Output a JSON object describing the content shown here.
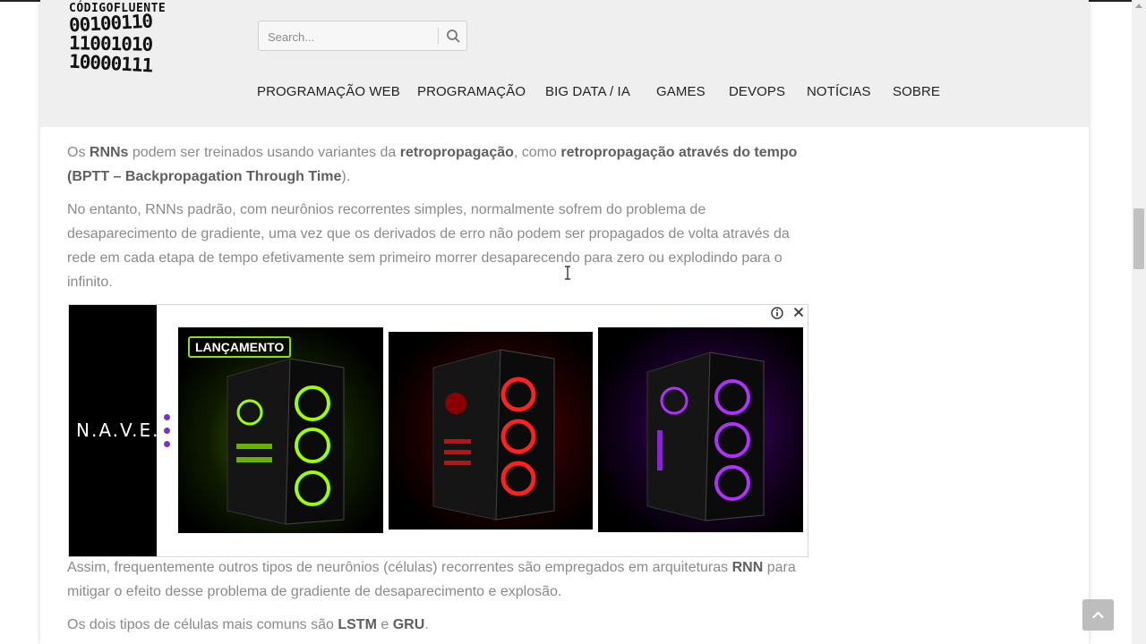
{
  "logo": {
    "brand": "CÓDIGOFLUENTE",
    "bits": [
      "00100110",
      "11001010",
      "10000111"
    ]
  },
  "search": {
    "placeholder": "Search...",
    "icon": "search-icon"
  },
  "nav": {
    "items": [
      "PROGRAMAÇÃO WEB",
      "PROGRAMAÇÃO",
      "BIG DATA / IA",
      "GAMES",
      "DEVOPS",
      "NOTÍCIAS",
      "SOBRE"
    ]
  },
  "article": {
    "p1": {
      "t1": "Os ",
      "b1": "RNNs",
      "t2": " podem ser treinados usando variantes da ",
      "b2": "retropropagação",
      "t3": ", como ",
      "b3": "retropropagação através do tempo (BPTT – Backpropagation Through Time",
      "t4": ")."
    },
    "p2": "No entanto, RNNs padrão, com neurônios recorrentes simples, normalmente sofrem do problema de desaparecimento de gradiente, uma vez que os derivados de erro não podem ser propagados de volta através da rede em cada etapa de tempo efetivamente sem primeiro morrer desaparecendo para zero ou explodindo para o infinito.",
    "p3": {
      "t1": "Assim, frequentemente outros tipos de neurônios (células) recorrentes são empregados em arquiteturas ",
      "b1": "RNN",
      "t2": " para mitigar o efeito desse problema de gradiente de desaparecimento e explosão."
    },
    "p4": {
      "t1": "Os dois tipos de células mais comuns são ",
      "b1": "LSTM",
      "t2": " e ",
      "b2": "GRU",
      "t3": "."
    }
  },
  "ad": {
    "brand": "N.A.V.E.",
    "badge": "LANÇAMENTO",
    "info_icon": "info-icon",
    "close_icon": "close-icon",
    "colors": {
      "green": "#9cff00",
      "red": "#ff2020",
      "purple": "#b030ff"
    }
  },
  "colors": {
    "header_bg": "#efefef",
    "text": "#8a8a8a",
    "bold_text": "#5f5f5f"
  }
}
